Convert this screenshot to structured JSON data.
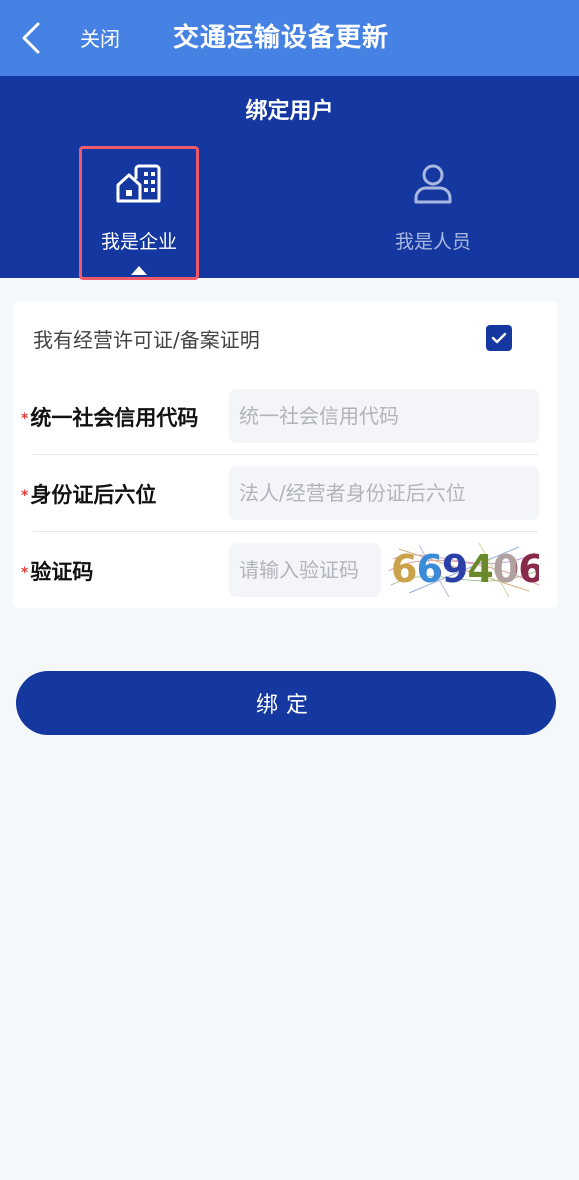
{
  "navbar": {
    "back_icon": "chevron-left-icon",
    "close_label": "关闭",
    "title": "交通运输设备更新"
  },
  "header": {
    "title": "绑定用户",
    "tabs": [
      {
        "label": "我是企业",
        "icon": "building-icon",
        "selected": true
      },
      {
        "label": "我是人员",
        "icon": "person-icon",
        "selected": false
      }
    ]
  },
  "form": {
    "license_label": "我有经营许可证/备案证明",
    "license_checked": true,
    "fields": [
      {
        "label": "统一社会信用代码",
        "placeholder": "统一社会信用代码",
        "value": ""
      },
      {
        "label": "身份证后六位",
        "placeholder": "法人/经营者身份证后六位",
        "value": ""
      },
      {
        "label": "验证码",
        "placeholder": "请输入验证码",
        "value": ""
      }
    ],
    "captcha_text": "669406"
  },
  "bind_button": {
    "label": "绑定"
  },
  "colors": {
    "navbar": "#4681e4",
    "header": "#1538a0",
    "selected_frame": "#f05a6a",
    "required": "#e23b3b"
  }
}
